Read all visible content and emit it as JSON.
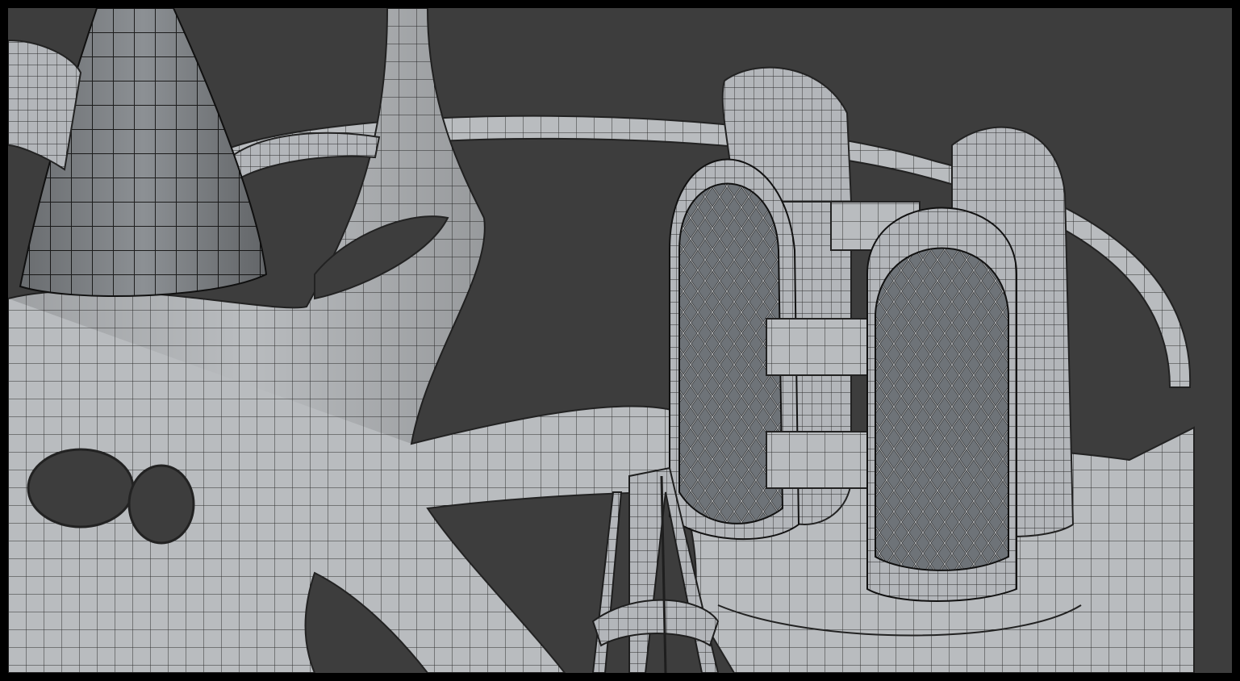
{
  "scene": {
    "kind": "3d-viewport-wireframe-render",
    "background_color": "#3d3d3d",
    "frame_color": "#000000",
    "surface_color": "#b9bcbf",
    "surface_shadow_color": "#8a8e93",
    "wire_color": "#2a2a2a",
    "glass_color": "#6e7378"
  },
  "objects": [
    {
      "name": "cone-tower",
      "description_label": ""
    },
    {
      "name": "ring-track",
      "description_label": ""
    },
    {
      "name": "branching-organic-structure",
      "description_label": ""
    },
    {
      "name": "twin-capsule-towers-left",
      "description_label": ""
    },
    {
      "name": "twin-capsule-towers-right",
      "description_label": ""
    },
    {
      "name": "lattice-spire",
      "description_label": ""
    },
    {
      "name": "round-plinth",
      "description_label": ""
    }
  ]
}
